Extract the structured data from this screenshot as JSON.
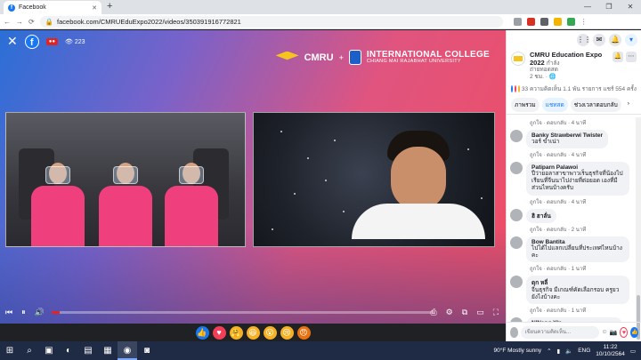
{
  "browser": {
    "tab_title": "Facebook",
    "url": "facebook.com/CMRUEduExpo2022/videos/350391916772821",
    "window_controls": [
      "—",
      "❐",
      "✕"
    ]
  },
  "video": {
    "viewer_count": "223",
    "brand": {
      "cmru": "CMRU",
      "plus": "+",
      "college_line1": "INTERNATIONAL COLLEGE",
      "college_line2": "CHIANG MAI RAJABHAT UNIVERSITY"
    },
    "progress_fraction": 0.02
  },
  "reactions": [
    {
      "name": "like-reaction-icon",
      "glyph": "👍",
      "color": "#1877f2"
    },
    {
      "name": "love-reaction-icon",
      "glyph": "♥",
      "color": "#f33e58"
    },
    {
      "name": "care-reaction-icon",
      "glyph": "🤗",
      "color": "#f7b125"
    },
    {
      "name": "haha-reaction-icon",
      "glyph": "😆",
      "color": "#f7b125"
    },
    {
      "name": "wow-reaction-icon",
      "glyph": "😮",
      "color": "#f7b125"
    },
    {
      "name": "sad-reaction-icon",
      "glyph": "😢",
      "color": "#f7b125"
    },
    {
      "name": "angry-reaction-icon",
      "glyph": "😠",
      "color": "#e9710f"
    }
  ],
  "sidebar": {
    "page_name": "CMRU Education Expo 2022",
    "page_status": "กำลัง",
    "page_sub": "ถ่ายทอดสด",
    "time": "2 ชม. · 🌐",
    "stats": "33 ความคิดเห็น 1.1 พัน รายการ แชร์ 554 ครั้ง",
    "tabs": [
      "ภาพรวม",
      "แชทสด",
      "ช่วงเวลาตอบกลับ"
    ],
    "comments": [
      {
        "name": "Banky Strawberwi Twister",
        "text": "วอร์ ขำเน่า",
        "meta": "ถูกใจ · ตอบกลับ · 4 นาที"
      },
      {
        "name": "Patiparn Palawoi",
        "text": "ปีว่ายอลาสาขาพาวเร็นธุรกิจที่น้องไปเรียนที่จีนนาไปง่ายที่ต่อยอด เองที่มีส่วนไหนบ้างครับ",
        "meta": "ถูกใจ · ตอบกลับ · 4 นาที"
      },
      {
        "name": "ฮิ ฮาลั่น",
        "text": "",
        "meta": "ถูกใจ · ตอบกลับ · 2 นาที"
      },
      {
        "name": "Bow Bantita",
        "text": "ไปได้ไปแลกเปลี่ยนที่ประเทศไหนบ้างคะ",
        "meta": "ถูกใจ · ตอบกลับ · 1 นาที"
      },
      {
        "name": "ดุก หลี่",
        "text": "จีนธุรกิจ มีเกณฑ์คัดเลือกรอบ ครูยวยังไงบ้างคะ",
        "meta": "ถูกใจ · ตอบกลับ · 1 นาที"
      },
      {
        "name": "N'Nang Y'n",
        "text": "จะได้ไปแลกเปลี่ยนไปจนปีไปปีปี่ได้",
        "meta": "ถูกใจ · ตอบกลับ · 1 นาที"
      }
    ],
    "first_meta": "ถูกใจ · ตอบกลับ · 4 นาที",
    "write_placeholder": "เขียนความคิดเห็น..."
  },
  "taskbar": {
    "weather": "90°F  Mostly sunny",
    "lang": "ENG",
    "time": "11:22",
    "date": "10/10/2564"
  }
}
